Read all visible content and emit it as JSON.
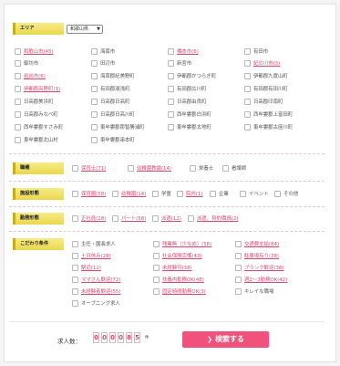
{
  "area": {
    "label": "エリア",
    "select_value": "和歌山県",
    "items": [
      {
        "label": "和歌山市(45)",
        "link": true
      },
      {
        "label": "海南市",
        "link": false
      },
      {
        "label": "橋本市(6)",
        "link": true
      },
      {
        "label": "有田市",
        "link": false
      },
      {
        "label": "御坊市",
        "link": false
      },
      {
        "label": "田辺市",
        "link": false
      },
      {
        "label": "新宮市",
        "link": false
      },
      {
        "label": "紀の川市(3)",
        "link": true
      },
      {
        "label": "岩出市(6)",
        "link": true
      },
      {
        "label": "海草郡紀美野町",
        "link": false
      },
      {
        "label": "伊都郡かつらぎ町",
        "link": false
      },
      {
        "label": "伊都郡九度山町",
        "link": false
      },
      {
        "label": "伊都郡高野町(1)",
        "link": true
      },
      {
        "label": "有田郡湯浅町",
        "link": false
      },
      {
        "label": "有田郡広川町",
        "link": false
      },
      {
        "label": "有田郡有田川町",
        "link": false
      },
      {
        "label": "日高郡美浜町",
        "link": false
      },
      {
        "label": "日高郡日高町",
        "link": false
      },
      {
        "label": "日高郡由良町",
        "link": false
      },
      {
        "label": "日高郡印南町",
        "link": false
      },
      {
        "label": "日高郡みなべ町",
        "link": false
      },
      {
        "label": "日高郡日高川町",
        "link": false
      },
      {
        "label": "西牟婁郡白浜町",
        "link": false
      },
      {
        "label": "西牟婁郡上富田町",
        "link": false
      },
      {
        "label": "西牟婁郡すさみ町",
        "link": false
      },
      {
        "label": "東牟婁郡那智勝浦町",
        "link": false
      },
      {
        "label": "東牟婁郡太地町",
        "link": false
      },
      {
        "label": "東牟婁郡古座川町",
        "link": false
      },
      {
        "label": "東牟婁郡北山村",
        "link": false
      },
      {
        "label": "東牟婁郡串本町",
        "link": false
      }
    ]
  },
  "job_type": {
    "label": "職種",
    "items": [
      {
        "label": "保育士(71)",
        "link": true
      },
      {
        "label": "幼稚園教諭(14)",
        "link": true
      },
      {
        "label": "栄養士",
        "link": false
      },
      {
        "label": "看護師",
        "link": false
      }
    ]
  },
  "facility": {
    "label": "施設形態",
    "items": [
      {
        "label": "保育園(58)",
        "link": true
      },
      {
        "label": "幼稚園(14)",
        "link": true
      },
      {
        "label": "学童",
        "link": false
      },
      {
        "label": "院内(1)",
        "link": true
      },
      {
        "label": "企業",
        "link": false
      },
      {
        "label": "イベント",
        "link": false
      },
      {
        "label": "その他",
        "link": false
      }
    ]
  },
  "employment": {
    "label": "勤務形態",
    "items": [
      {
        "label": "正社員(28)",
        "link": true
      },
      {
        "label": "パート(58)",
        "link": true
      },
      {
        "label": "派遣(12)",
        "link": true
      },
      {
        "label": "派遣、契約職員(2)",
        "link": true
      }
    ]
  },
  "conditions": {
    "label": "こだわり条件",
    "items": [
      {
        "label": "主任・園長求人",
        "link": false
      },
      {
        "label": "残業無（少なめ）(58)",
        "link": true
      },
      {
        "label": "交通費支給(84)",
        "link": true
      },
      {
        "label": "土日休み(28)",
        "link": true
      },
      {
        "label": "社会保険完備(43)",
        "link": true
      },
      {
        "label": "駐車場有り(38)",
        "link": true
      },
      {
        "label": "駅近(12)",
        "link": true
      },
      {
        "label": "未経験可(38)",
        "link": true
      },
      {
        "label": "ブランク歓迎(38)",
        "link": true
      },
      {
        "label": "ママさん歓迎(72)",
        "link": true
      },
      {
        "label": "扶養内勤務OK(48)",
        "link": true
      },
      {
        "label": "週2〜3勤務OK(42)",
        "link": true
      },
      {
        "label": "未経験者歓迎(55)",
        "link": true
      },
      {
        "label": "固定時間勤務OK(3)",
        "link": true
      },
      {
        "label": "キレイな職場",
        "link": false
      },
      {
        "label": "オープニング求人",
        "link": false
      }
    ]
  },
  "footer": {
    "count_label": "求人数：",
    "digits": [
      "0",
      "0",
      "0",
      "0",
      "8",
      "5"
    ],
    "unit": "件",
    "search_button": "検索する",
    "search_icon": "chevron-right-icon"
  }
}
